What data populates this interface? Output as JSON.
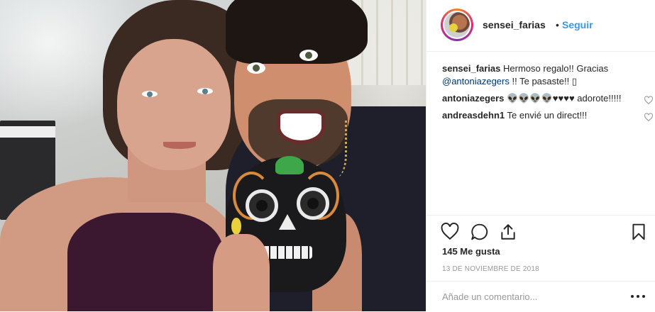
{
  "post": {
    "photo": {
      "icon": "post-photo"
    },
    "header": {
      "username": "sensei_farias",
      "separator": "•",
      "follow_label": "Seguir"
    },
    "caption": {
      "user": "sensei_farias",
      "text_before": "Hermoso regalo!! Gracias",
      "mention": "@antoniazegers",
      "text_after": "!! Te pasaste!! ▯"
    },
    "comments": [
      {
        "user": "antoniazegers",
        "text": "👽👽👽👽♥♥♥♥ adorote!!!!!"
      },
      {
        "user": "andreasdehn1",
        "text": "Te envié un direct!!!"
      }
    ],
    "actions": {
      "like_icon": "heart-icon",
      "comment_icon": "comment-icon",
      "share_icon": "share-icon",
      "save_icon": "bookmark-icon"
    },
    "likes_text": "145 Me gusta",
    "date": "13 DE NOVIEMBRE DE 2018",
    "add_comment_placeholder": "Añade un comentario...",
    "more_icon": "more-options-icon",
    "colors": {
      "link": "#003569",
      "follow": "#3897f0",
      "text": "#262626",
      "muted": "#999999",
      "border": "#efefef"
    }
  }
}
